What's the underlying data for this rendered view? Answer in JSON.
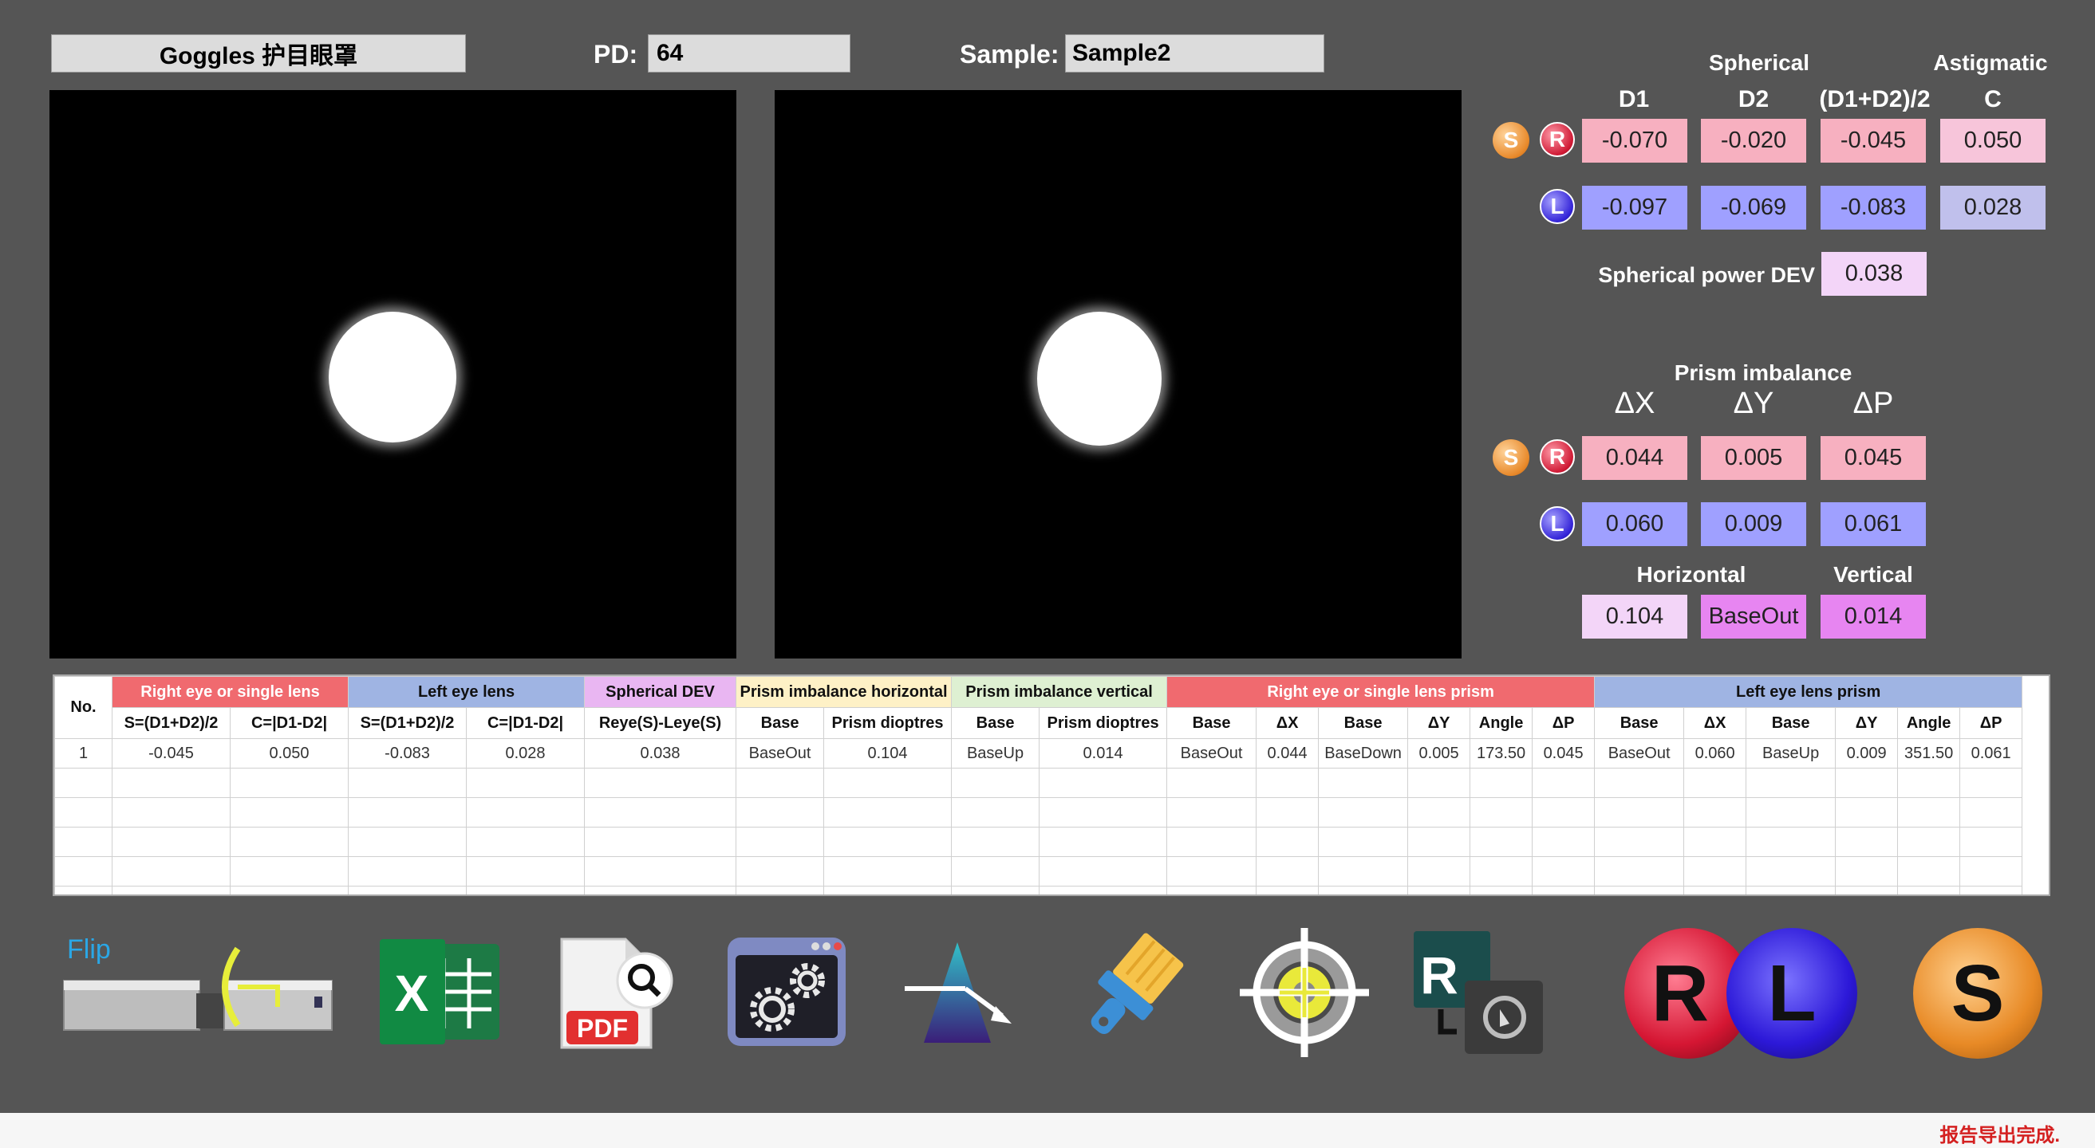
{
  "top": {
    "mode_value": "Goggles 护目眼罩",
    "pd_label": "PD:",
    "pd_value": "64",
    "sample_label": "Sample:",
    "sample_value": "Sample2"
  },
  "spherical": {
    "title": "Spherical",
    "astig_title": "Astigmatic",
    "col_d1": "D1",
    "col_d2": "D2",
    "col_avg": "(D1+D2)/2",
    "col_c": "C",
    "right": {
      "d1": "-0.070",
      "d2": "-0.020",
      "avg": "-0.045",
      "c": "0.050"
    },
    "left": {
      "d1": "-0.097",
      "d2": "-0.069",
      "avg": "-0.083",
      "c": "0.028"
    },
    "dev_label": "Spherical power DEV",
    "dev_value": "0.038"
  },
  "prism": {
    "title": "Prism imbalance",
    "col_dx": "ΔX",
    "col_dy": "ΔY",
    "col_dp": "ΔP",
    "right": {
      "dx": "0.044",
      "dy": "0.005",
      "dp": "0.045"
    },
    "left": {
      "dx": "0.060",
      "dy": "0.009",
      "dp": "0.061"
    },
    "horizontal_label": "Horizontal",
    "vertical_label": "Vertical",
    "horizontal_value": "0.104",
    "base_value": "BaseOut",
    "vertical_value": "0.014"
  },
  "badges": {
    "s": "S",
    "r": "R",
    "l": "L"
  },
  "table": {
    "no_header": "No.",
    "groups": [
      {
        "label": "Right eye or single lens",
        "span": 2,
        "cls": "c-red"
      },
      {
        "label": "Left eye lens",
        "span": 2,
        "cls": "c-blue"
      },
      {
        "label": "Spherical DEV",
        "span": 1,
        "cls": "c-vio"
      },
      {
        "label": "Prism imbalance horizontal",
        "span": 2,
        "cls": "c-yel"
      },
      {
        "label": "Prism imbalance vertical",
        "span": 2,
        "cls": "c-grn"
      },
      {
        "label": "Right eye or single lens prism",
        "span": 6,
        "cls": "c-red"
      },
      {
        "label": "Left eye lens prism",
        "span": 6,
        "cls": "c-blue"
      }
    ],
    "subheaders": [
      "S=(D1+D2)/2",
      "C=|D1-D2|",
      "S=(D1+D2)/2",
      "C=|D1-D2|",
      "Reye(S)-Leye(S)",
      "Base",
      "Prism dioptres",
      "Base",
      "Prism dioptres",
      "Base",
      "ΔX",
      "Base",
      "ΔY",
      "Angle",
      "ΔP",
      "Base",
      "ΔX",
      "Base",
      "ΔY",
      "Angle",
      "ΔP"
    ],
    "rows": [
      [
        "1",
        "-0.045",
        "0.050",
        "-0.083",
        "0.028",
        "0.038",
        "BaseOut",
        "0.104",
        "BaseUp",
        "0.014",
        "BaseOut",
        "0.044",
        "BaseDown",
        "0.005",
        "173.50",
        "0.045",
        "BaseOut",
        "0.060",
        "BaseUp",
        "0.009",
        "351.50",
        "0.061"
      ]
    ]
  },
  "toolbar": {
    "flip_label": "Flip",
    "pdf_label": "PDF",
    "r_label": "R",
    "l_label": "L",
    "s_label": "S",
    "x_label": "X"
  },
  "status": {
    "message": "报告导出完成."
  }
}
